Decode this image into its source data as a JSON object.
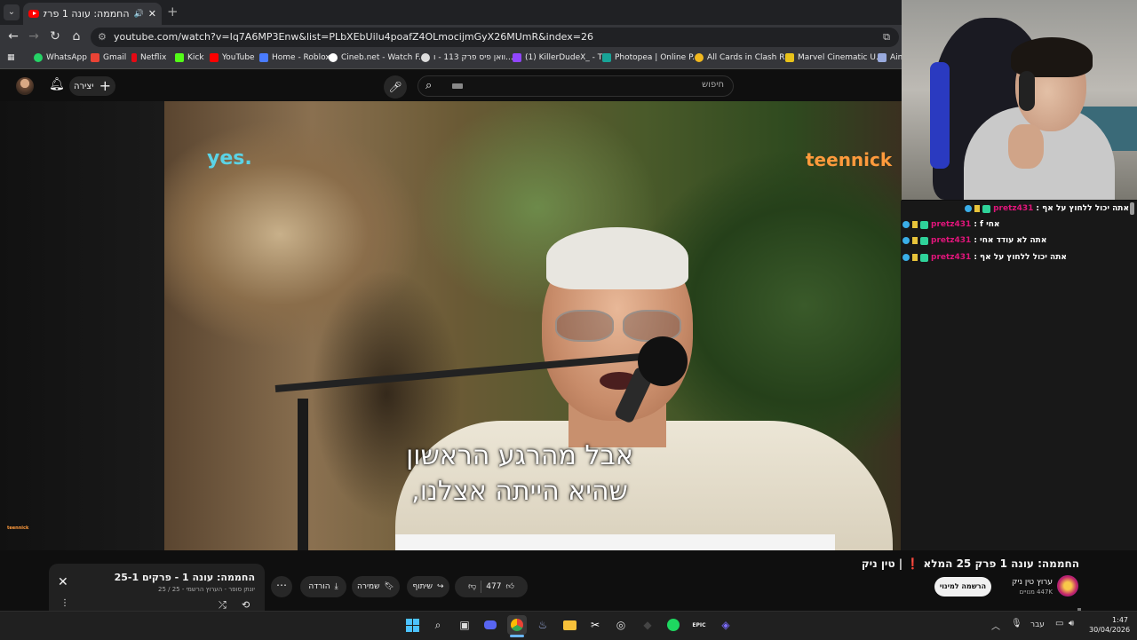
{
  "browser": {
    "tab_title": "החממה: עונה 1 פרק 25 המ",
    "url": "youtube.com/watch?v=Iq7A6MP3Enw&list=PLbXEbUilu4poafZ4OLmocijmGyX26MUmR&index=26",
    "bookmarks": [
      {
        "label": "WhatsApp",
        "color": "#25d366"
      },
      {
        "label": "Gmail",
        "color": "#ea4335"
      },
      {
        "label": "Netflix",
        "color": "#e50914"
      },
      {
        "label": "Kick",
        "color": "#53fc18"
      },
      {
        "label": "YouTube",
        "color": "#ff0000"
      },
      {
        "label": "Home - Roblox",
        "color": "#4a7cff"
      },
      {
        "label": "Cineb.net - Watch F...",
        "color": "#ffffff"
      },
      {
        "label": "וואן פיס פרק 113 - ו...",
        "color": "#dddddd"
      },
      {
        "label": "(1) KillerDudeX_ - T...",
        "color": "#9146ff"
      },
      {
        "label": "Photopea | Online P...",
        "color": "#18a497"
      },
      {
        "label": "All Cards in Clash R...",
        "color": "#f2b91f"
      },
      {
        "label": "Marvel Cinematic U...",
        "color": "#e8c21a"
      },
      {
        "label": "Aim",
        "color": "#9ad"
      }
    ]
  },
  "youtube_header": {
    "create_label": "יצירה",
    "search_placeholder": "חיפוש"
  },
  "video": {
    "logo_left": "yes.",
    "logo_right": "teennick",
    "subtitle_line1": "אבל מהרגע הראשון",
    "subtitle_line2": "שהיא הייתה אצלנו,",
    "corner_logo": "teennick"
  },
  "chat": [
    {
      "user": "pretz431",
      "message": "אתה יכול ללחוץ על אף :"
    },
    {
      "user": "pretz431",
      "message": "אחי f :"
    },
    {
      "user": "pretz431",
      "message": "אתה לא עודד אחי :"
    },
    {
      "user": "pretz431",
      "message": "אתה יכול ללחוץ על אף :"
    }
  ],
  "watch": {
    "title": "החממה: עונה 1 פרק 25 המלא ❗ | טין ניק",
    "channel_name": "ערוץ טין ניק",
    "channel_subs": "447K מנויים",
    "subscribe_label": "הרשמה למינוי",
    "like_count": "477",
    "share_label": "שיתוף",
    "save_label": "שמירה",
    "download_label": "הורדה"
  },
  "playlist": {
    "title": "החממה: עונה 1 - פרקים 25-1",
    "subtitle": "יונתן סופר - הערוץ הרשמי - 25 / 25"
  },
  "taskbar": {
    "language": "עבר",
    "time": "1:47",
    "date": "30/04/2026"
  }
}
